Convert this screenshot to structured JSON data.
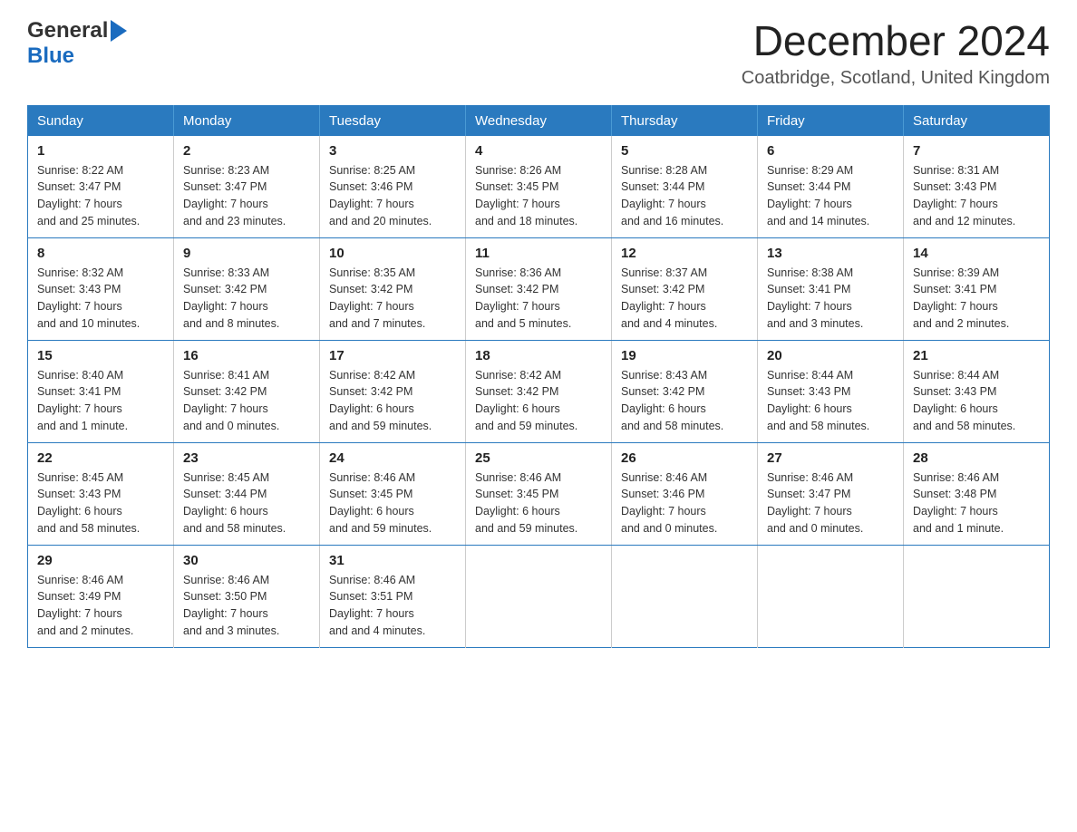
{
  "header": {
    "logo_general": "General",
    "logo_blue": "Blue",
    "month_title": "December 2024",
    "location": "Coatbridge, Scotland, United Kingdom"
  },
  "weekdays": [
    "Sunday",
    "Monday",
    "Tuesday",
    "Wednesday",
    "Thursday",
    "Friday",
    "Saturday"
  ],
  "weeks": [
    [
      {
        "day": "1",
        "sunrise": "8:22 AM",
        "sunset": "3:47 PM",
        "daylight": "7 hours and 25 minutes."
      },
      {
        "day": "2",
        "sunrise": "8:23 AM",
        "sunset": "3:47 PM",
        "daylight": "7 hours and 23 minutes."
      },
      {
        "day": "3",
        "sunrise": "8:25 AM",
        "sunset": "3:46 PM",
        "daylight": "7 hours and 20 minutes."
      },
      {
        "day": "4",
        "sunrise": "8:26 AM",
        "sunset": "3:45 PM",
        "daylight": "7 hours and 18 minutes."
      },
      {
        "day": "5",
        "sunrise": "8:28 AM",
        "sunset": "3:44 PM",
        "daylight": "7 hours and 16 minutes."
      },
      {
        "day": "6",
        "sunrise": "8:29 AM",
        "sunset": "3:44 PM",
        "daylight": "7 hours and 14 minutes."
      },
      {
        "day": "7",
        "sunrise": "8:31 AM",
        "sunset": "3:43 PM",
        "daylight": "7 hours and 12 minutes."
      }
    ],
    [
      {
        "day": "8",
        "sunrise": "8:32 AM",
        "sunset": "3:43 PM",
        "daylight": "7 hours and 10 minutes."
      },
      {
        "day": "9",
        "sunrise": "8:33 AM",
        "sunset": "3:42 PM",
        "daylight": "7 hours and 8 minutes."
      },
      {
        "day": "10",
        "sunrise": "8:35 AM",
        "sunset": "3:42 PM",
        "daylight": "7 hours and 7 minutes."
      },
      {
        "day": "11",
        "sunrise": "8:36 AM",
        "sunset": "3:42 PM",
        "daylight": "7 hours and 5 minutes."
      },
      {
        "day": "12",
        "sunrise": "8:37 AM",
        "sunset": "3:42 PM",
        "daylight": "7 hours and 4 minutes."
      },
      {
        "day": "13",
        "sunrise": "8:38 AM",
        "sunset": "3:41 PM",
        "daylight": "7 hours and 3 minutes."
      },
      {
        "day": "14",
        "sunrise": "8:39 AM",
        "sunset": "3:41 PM",
        "daylight": "7 hours and 2 minutes."
      }
    ],
    [
      {
        "day": "15",
        "sunrise": "8:40 AM",
        "sunset": "3:41 PM",
        "daylight": "7 hours and 1 minute."
      },
      {
        "day": "16",
        "sunrise": "8:41 AM",
        "sunset": "3:42 PM",
        "daylight": "7 hours and 0 minutes."
      },
      {
        "day": "17",
        "sunrise": "8:42 AM",
        "sunset": "3:42 PM",
        "daylight": "6 hours and 59 minutes."
      },
      {
        "day": "18",
        "sunrise": "8:42 AM",
        "sunset": "3:42 PM",
        "daylight": "6 hours and 59 minutes."
      },
      {
        "day": "19",
        "sunrise": "8:43 AM",
        "sunset": "3:42 PM",
        "daylight": "6 hours and 58 minutes."
      },
      {
        "day": "20",
        "sunrise": "8:44 AM",
        "sunset": "3:43 PM",
        "daylight": "6 hours and 58 minutes."
      },
      {
        "day": "21",
        "sunrise": "8:44 AM",
        "sunset": "3:43 PM",
        "daylight": "6 hours and 58 minutes."
      }
    ],
    [
      {
        "day": "22",
        "sunrise": "8:45 AM",
        "sunset": "3:43 PM",
        "daylight": "6 hours and 58 minutes."
      },
      {
        "day": "23",
        "sunrise": "8:45 AM",
        "sunset": "3:44 PM",
        "daylight": "6 hours and 58 minutes."
      },
      {
        "day": "24",
        "sunrise": "8:46 AM",
        "sunset": "3:45 PM",
        "daylight": "6 hours and 59 minutes."
      },
      {
        "day": "25",
        "sunrise": "8:46 AM",
        "sunset": "3:45 PM",
        "daylight": "6 hours and 59 minutes."
      },
      {
        "day": "26",
        "sunrise": "8:46 AM",
        "sunset": "3:46 PM",
        "daylight": "7 hours and 0 minutes."
      },
      {
        "day": "27",
        "sunrise": "8:46 AM",
        "sunset": "3:47 PM",
        "daylight": "7 hours and 0 minutes."
      },
      {
        "day": "28",
        "sunrise": "8:46 AM",
        "sunset": "3:48 PM",
        "daylight": "7 hours and 1 minute."
      }
    ],
    [
      {
        "day": "29",
        "sunrise": "8:46 AM",
        "sunset": "3:49 PM",
        "daylight": "7 hours and 2 minutes."
      },
      {
        "day": "30",
        "sunrise": "8:46 AM",
        "sunset": "3:50 PM",
        "daylight": "7 hours and 3 minutes."
      },
      {
        "day": "31",
        "sunrise": "8:46 AM",
        "sunset": "3:51 PM",
        "daylight": "7 hours and 4 minutes."
      },
      null,
      null,
      null,
      null
    ]
  ],
  "labels": {
    "sunrise": "Sunrise:",
    "sunset": "Sunset:",
    "daylight": "Daylight:"
  }
}
